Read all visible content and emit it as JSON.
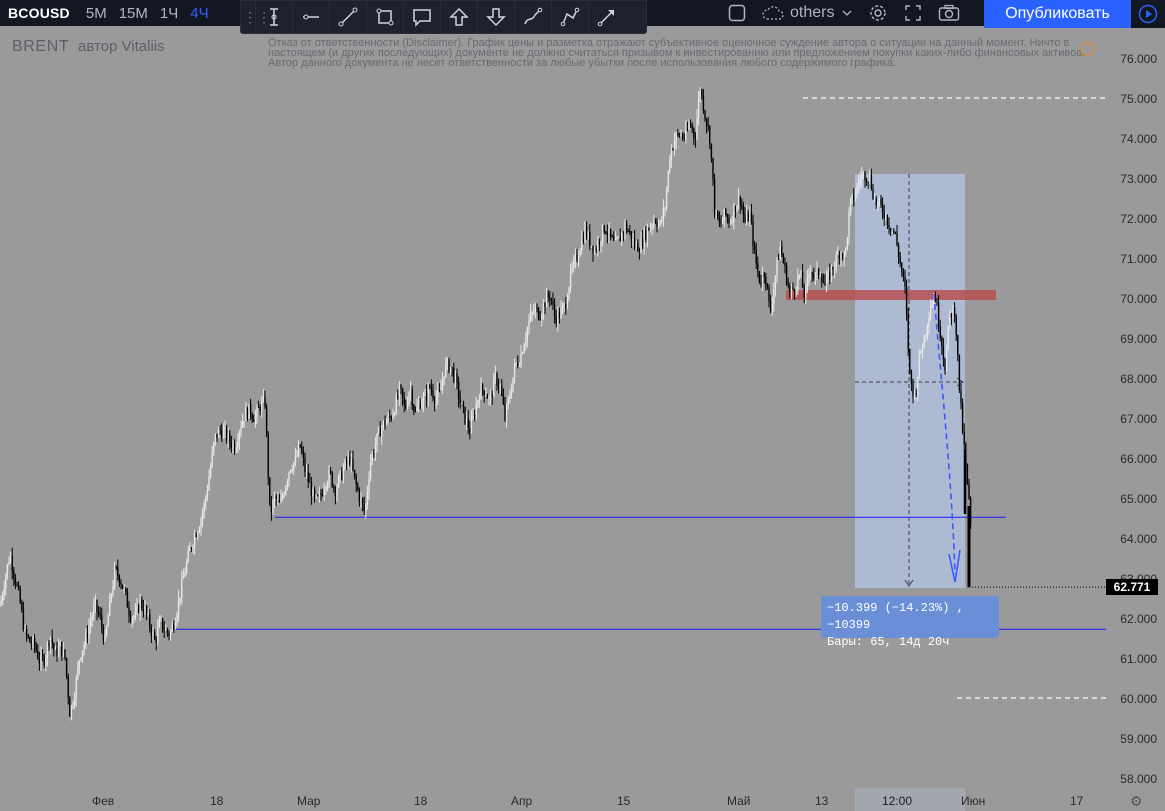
{
  "toolbar": {
    "symbol": "BCOUSD",
    "timeframes": [
      "5M",
      "15M",
      "1Ч",
      "4Ч"
    ],
    "active_timeframe": "4Ч",
    "others_label": "others",
    "publish_label": "Опубликовать"
  },
  "drawing_tools": [
    "cross-line-icon",
    "horizontal-line-icon",
    "trend-line-icon",
    "rectangle-icon",
    "callout-icon",
    "arrow-up-icon",
    "arrow-down-icon",
    "brush-icon",
    "path-icon",
    "arrow-icon"
  ],
  "watermark": {
    "title": "BRENT",
    "author": "автор Vitaliis"
  },
  "disclaimer": "Отказ от ответственности (Disclaimer). График цены и разметка отражают субъективное оценочное суждение автора о ситуации на данный момент. Ничто в настоящем (и других последующих) документе не должно считаться призывом к инвестированию или предложением покупки каких-либо финансовых активов. Автор данного документа не несет ответственности за любые убытки после использования любого содержимого графика.",
  "price_axis": [
    "76.000",
    "75.000",
    "74.000",
    "73.000",
    "72.000",
    "71.000",
    "70.000",
    "69.000",
    "68.000",
    "67.000",
    "66.000",
    "65.000",
    "64.000",
    "63.000",
    "62.000",
    "61.000",
    "60.000",
    "59.000",
    "58.000"
  ],
  "current_price": "62.771",
  "time_axis": [
    "Фев",
    "18",
    "Мар",
    "18",
    "Апр",
    "15",
    "Май",
    "13",
    "12:00",
    "Июн",
    "17"
  ],
  "measure": {
    "line1": "−10.399 (−14.23%) , −10399",
    "line2": "Бары: 65, 14д 20ч"
  },
  "colors": {
    "background": "#9a9a9a",
    "up_candle": "#e8e8e8",
    "down_candle": "#000000",
    "support_line": "#1a1aff",
    "resistance_zone": "#b84a4a",
    "measure_box": "#b0c0dc",
    "accent": "#2962ff"
  },
  "chart_data": {
    "type": "candlestick",
    "symbol": "BCOUSD",
    "ylim": [
      57.6,
      76.6
    ],
    "close_path": [
      [
        0,
        62.3
      ],
      [
        5,
        63.0
      ],
      [
        10,
        63.6
      ],
      [
        15,
        63.0
      ],
      [
        20,
        62.4
      ],
      [
        25,
        61.6
      ],
      [
        30,
        61.4
      ],
      [
        35,
        61.3
      ],
      [
        40,
        60.9
      ],
      [
        45,
        61.0
      ],
      [
        50,
        61.6
      ],
      [
        55,
        61.1
      ],
      [
        60,
        61.3
      ],
      [
        65,
        61.0
      ],
      [
        70,
        59.6
      ],
      [
        75,
        60.2
      ],
      [
        80,
        61.1
      ],
      [
        85,
        61.4
      ],
      [
        90,
        61.9
      ],
      [
        95,
        62.3
      ],
      [
        100,
        62.0
      ],
      [
        105,
        61.4
      ],
      [
        110,
        62.4
      ],
      [
        115,
        63.2
      ],
      [
        120,
        63.0
      ],
      [
        125,
        62.6
      ],
      [
        130,
        62.1
      ],
      [
        135,
        62.0
      ],
      [
        140,
        62.4
      ],
      [
        145,
        62.2
      ],
      [
        150,
        61.8
      ],
      [
        155,
        61.4
      ],
      [
        160,
        61.9
      ],
      [
        165,
        61.7
      ],
      [
        170,
        61.6
      ],
      [
        175,
        62.0
      ],
      [
        180,
        62.6
      ],
      [
        185,
        63.2
      ],
      [
        190,
        63.7
      ],
      [
        195,
        64.1
      ],
      [
        200,
        64.4
      ],
      [
        205,
        64.9
      ],
      [
        210,
        65.7
      ],
      [
        215,
        66.5
      ],
      [
        220,
        66.7
      ],
      [
        225,
        66.6
      ],
      [
        230,
        66.4
      ],
      [
        235,
        66.3
      ],
      [
        240,
        66.8
      ],
      [
        245,
        67.1
      ],
      [
        250,
        67.2
      ],
      [
        255,
        67.0
      ],
      [
        260,
        67.3
      ],
      [
        265,
        67.4
      ],
      [
        270,
        64.6
      ],
      [
        275,
        65.0
      ],
      [
        280,
        64.8
      ],
      [
        285,
        65.3
      ],
      [
        290,
        65.8
      ],
      [
        295,
        65.9
      ],
      [
        300,
        66.3
      ],
      [
        305,
        65.7
      ],
      [
        310,
        65.3
      ],
      [
        315,
        64.9
      ],
      [
        320,
        65.0
      ],
      [
        325,
        65.4
      ],
      [
        330,
        65.6
      ],
      [
        335,
        65.2
      ],
      [
        340,
        65.5
      ],
      [
        345,
        65.8
      ],
      [
        350,
        66.0
      ],
      [
        355,
        65.4
      ],
      [
        360,
        65.0
      ],
      [
        365,
        64.6
      ],
      [
        370,
        65.9
      ],
      [
        375,
        66.3
      ],
      [
        380,
        66.7
      ],
      [
        385,
        66.9
      ],
      [
        390,
        67.0
      ],
      [
        395,
        67.3
      ],
      [
        400,
        67.7
      ],
      [
        405,
        67.2
      ],
      [
        410,
        67.8
      ],
      [
        415,
        67.1
      ],
      [
        420,
        67.4
      ],
      [
        425,
        67.5
      ],
      [
        430,
        67.8
      ],
      [
        435,
        67.5
      ],
      [
        440,
        67.6
      ],
      [
        445,
        68.3
      ],
      [
        450,
        68.3
      ],
      [
        455,
        68.0
      ],
      [
        460,
        67.4
      ],
      [
        465,
        67.0
      ],
      [
        470,
        66.7
      ],
      [
        475,
        67.2
      ],
      [
        480,
        67.7
      ],
      [
        485,
        67.7
      ],
      [
        490,
        67.4
      ],
      [
        495,
        68.0
      ],
      [
        500,
        67.8
      ],
      [
        505,
        67.0
      ],
      [
        510,
        67.6
      ],
      [
        515,
        68.3
      ],
      [
        520,
        68.5
      ],
      [
        525,
        69.0
      ],
      [
        530,
        69.5
      ],
      [
        535,
        69.7
      ],
      [
        540,
        69.6
      ],
      [
        545,
        69.9
      ],
      [
        550,
        70.1
      ],
      [
        555,
        69.5
      ],
      [
        560,
        69.6
      ],
      [
        565,
        69.8
      ],
      [
        570,
        70.5
      ],
      [
        575,
        70.9
      ],
      [
        580,
        71.3
      ],
      [
        585,
        71.7
      ],
      [
        590,
        71.4
      ],
      [
        595,
        71.2
      ],
      [
        600,
        71.5
      ],
      [
        605,
        71.8
      ],
      [
        610,
        71.5
      ],
      [
        615,
        71.3
      ],
      [
        620,
        71.5
      ],
      [
        625,
        71.8
      ],
      [
        630,
        71.6
      ],
      [
        635,
        71.3
      ],
      [
        640,
        71.3
      ],
      [
        645,
        71.6
      ],
      [
        650,
        71.8
      ],
      [
        655,
        72.0
      ],
      [
        660,
        71.8
      ],
      [
        665,
        72.3
      ],
      [
        670,
        73.6
      ],
      [
        675,
        74.0
      ],
      [
        680,
        74.1
      ],
      [
        685,
        74.0
      ],
      [
        690,
        74.4
      ],
      [
        695,
        74.0
      ],
      [
        700,
        75.3
      ],
      [
        705,
        74.6
      ],
      [
        710,
        74.0
      ],
      [
        715,
        72.1
      ],
      [
        720,
        71.8
      ],
      [
        725,
        72.1
      ],
      [
        730,
        71.9
      ],
      [
        735,
        72.3
      ],
      [
        740,
        72.5
      ],
      [
        745,
        71.9
      ],
      [
        750,
        72.1
      ],
      [
        755,
        71.0
      ],
      [
        760,
        70.4
      ],
      [
        765,
        70.7
      ],
      [
        770,
        69.6
      ],
      [
        775,
        70.5
      ],
      [
        780,
        71.3
      ],
      [
        785,
        70.7
      ],
      [
        790,
        70.1
      ],
      [
        795,
        70.3
      ],
      [
        800,
        70.6
      ],
      [
        805,
        70.0
      ],
      [
        810,
        70.8
      ],
      [
        815,
        70.5
      ],
      [
        820,
        70.7
      ],
      [
        825,
        70.3
      ],
      [
        830,
        70.6
      ],
      [
        835,
        70.9
      ],
      [
        840,
        71.2
      ],
      [
        845,
        71.0
      ],
      [
        850,
        72.3
      ],
      [
        855,
        72.6
      ],
      [
        860,
        73.0
      ],
      [
        865,
        73.1
      ],
      [
        870,
        73.0
      ],
      [
        875,
        72.4
      ],
      [
        880,
        72.3
      ],
      [
        885,
        72.1
      ],
      [
        890,
        71.8
      ],
      [
        895,
        71.6
      ],
      [
        900,
        70.9
      ],
      [
        905,
        70.2
      ],
      [
        910,
        68.0
      ],
      [
        915,
        67.5
      ],
      [
        920,
        68.6
      ],
      [
        925,
        69.1
      ],
      [
        930,
        69.8
      ],
      [
        935,
        70.1
      ],
      [
        940,
        69.2
      ],
      [
        945,
        68.3
      ],
      [
        950,
        69.6
      ],
      [
        955,
        69.7
      ],
      [
        960,
        67.5
      ],
      [
        965,
        66.0
      ],
      [
        970,
        64.6
      ],
      [
        973,
        62.8
      ]
    ],
    "horizontal_levels": [
      64.52,
      61.72
    ],
    "resistance_zone": [
      69.95,
      70.2
    ],
    "dashed_levels": [
      75.0,
      60.0
    ],
    "price_marker": 62.771
  }
}
